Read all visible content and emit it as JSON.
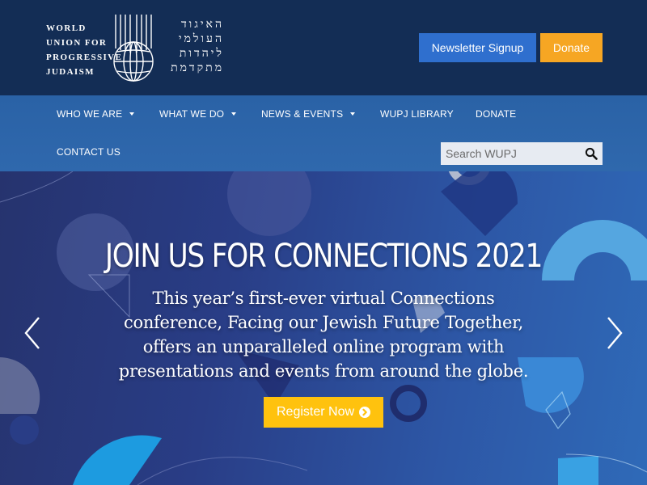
{
  "header": {
    "logo_en_lines": [
      "WORLD",
      "UNION FOR",
      "PROGRESSIVE",
      "JUDAISM"
    ],
    "logo_he_lines": [
      "האיגוד",
      "העולמי",
      "ליהדות",
      "מתקדמת"
    ],
    "newsletter_label": "Newsletter Signup",
    "donate_label": "Donate"
  },
  "nav": {
    "items": [
      {
        "label": "WHO WE ARE",
        "has_dropdown": true
      },
      {
        "label": "WHAT WE DO",
        "has_dropdown": true
      },
      {
        "label": "NEWS & EVENTS",
        "has_dropdown": true
      },
      {
        "label": "WUPJ LIBRARY",
        "has_dropdown": false
      },
      {
        "label": "DONATE",
        "has_dropdown": false
      },
      {
        "label": "CONTACT US",
        "has_dropdown": false
      }
    ],
    "search_placeholder": "Search WUPJ"
  },
  "hero": {
    "title": "JOIN US FOR CONNECTIONS 2021",
    "text": "This year’s first-ever virtual Connections conference, Facing our Jewish Future Together, offers an unparalleled online program with presentations and events from around the globe.",
    "button_label": "Register Now"
  },
  "colors": {
    "header_bg": "#132d55",
    "nav_bg": "#2f68ad",
    "newsletter_btn": "#2f6fce",
    "donate_btn": "#f6a623",
    "register_btn": "#ffc20e"
  },
  "icons": [
    "logo-emblem",
    "caret-down-icon",
    "search-icon",
    "chevron-left-icon",
    "chevron-right-icon",
    "arrow-circle-right-icon"
  ]
}
